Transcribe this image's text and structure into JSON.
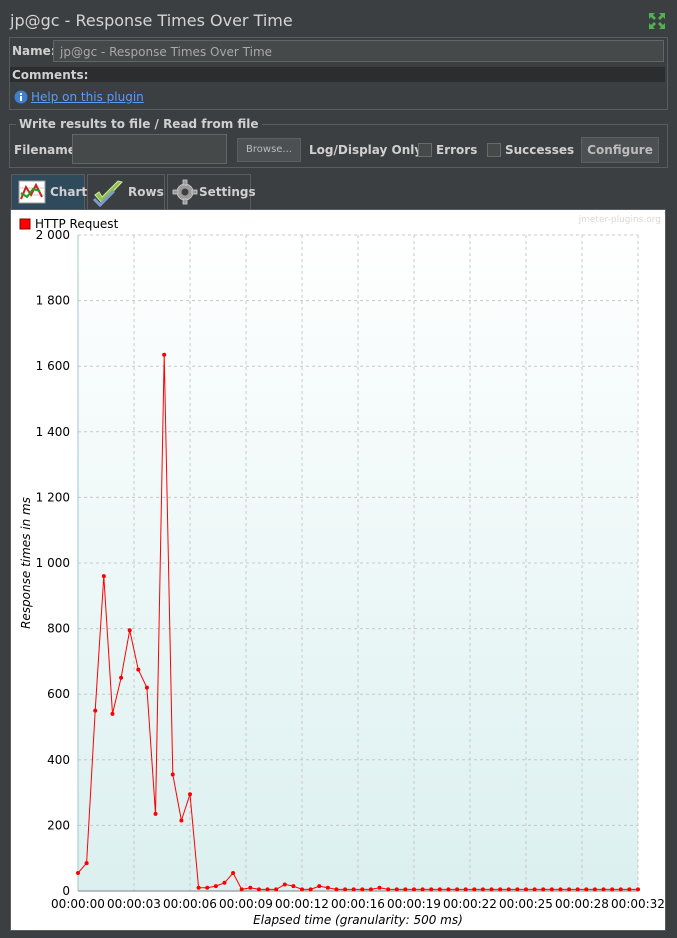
{
  "window": {
    "title": "jp@gc - Response Times Over Time"
  },
  "name_field": {
    "label": "Name:",
    "value": "jp@gc - Response Times Over Time"
  },
  "comments": {
    "label": "Comments:"
  },
  "help": {
    "link_text": "Help on this plugin"
  },
  "file_section": {
    "legend": "Write results to file / Read from file",
    "filename_label": "Filename",
    "browse_label": "Browse...",
    "log_display_label": "Log/Display Only:",
    "errors_label": "Errors",
    "successes_label": "Successes",
    "configure_label": "Configure"
  },
  "tabs": [
    {
      "label": "Chart",
      "icon": "chart-icon",
      "active": true
    },
    {
      "label": "Rows",
      "icon": "checkmark-icon",
      "active": false
    },
    {
      "label": "Settings",
      "icon": "gear-icon",
      "active": false
    }
  ],
  "colors": {
    "series": "#ff0000",
    "accent": "#2f4a5a"
  },
  "chart_data": {
    "type": "line",
    "watermark": "jmeter-plugins.org",
    "xlabel": "Elapsed time (granularity: 500 ms)",
    "ylabel": "Response times in ms",
    "ylim": [
      0,
      2000
    ],
    "xlim": [
      0,
      32.5
    ],
    "yticks": [
      0,
      200,
      400,
      600,
      800,
      1000,
      1200,
      1400,
      1600,
      1800,
      2000
    ],
    "ytick_labels": [
      "0",
      "200",
      "400",
      "600",
      "800",
      "1 000",
      "1 200",
      "1 400",
      "1 600",
      "1 800",
      "2 000"
    ],
    "xticks": [
      0,
      3.25,
      6.5,
      9.75,
      13,
      16.25,
      19.5,
      22.75,
      26,
      29.25,
      32.5
    ],
    "xtick_labels": [
      "00:00:00",
      "00:00:03",
      "00:00:06",
      "00:00:09",
      "00:00:12",
      "00:00:16",
      "00:00:19",
      "00:00:22",
      "00:00:25",
      "00:00:28",
      "00:00:32"
    ],
    "grid": true,
    "legend_position": "top-left",
    "series": [
      {
        "name": "HTTP Request",
        "color": "#ff0000",
        "x": [
          0,
          0.5,
          1,
          1.5,
          2,
          2.5,
          3,
          3.5,
          4,
          4.5,
          5,
          5.5,
          6,
          6.5,
          7,
          7.5,
          8,
          8.5,
          9,
          9.5,
          10,
          10.5,
          11,
          11.5,
          12,
          12.5,
          13,
          13.5,
          14,
          14.5,
          15,
          15.5,
          16,
          16.5,
          17,
          17.5,
          18,
          18.5,
          19,
          19.5,
          20,
          20.5,
          21,
          21.5,
          22,
          22.5,
          23,
          23.5,
          24,
          24.5,
          25,
          25.5,
          26,
          26.5,
          27,
          27.5,
          28,
          28.5,
          29,
          29.5,
          30,
          30.5,
          31,
          31.5,
          32,
          32.5
        ],
        "values": [
          55,
          85,
          550,
          960,
          540,
          650,
          795,
          675,
          620,
          235,
          1635,
          355,
          215,
          295,
          10,
          10,
          15,
          25,
          55,
          5,
          10,
          5,
          5,
          5,
          20,
          15,
          5,
          5,
          15,
          10,
          5,
          5,
          5,
          5,
          5,
          10,
          5,
          5,
          5,
          5,
          5,
          5,
          5,
          5,
          5,
          5,
          5,
          5,
          5,
          5,
          5,
          5,
          5,
          5,
          5,
          5,
          5,
          5,
          5,
          5,
          5,
          5,
          5,
          5,
          5,
          5
        ]
      }
    ]
  }
}
